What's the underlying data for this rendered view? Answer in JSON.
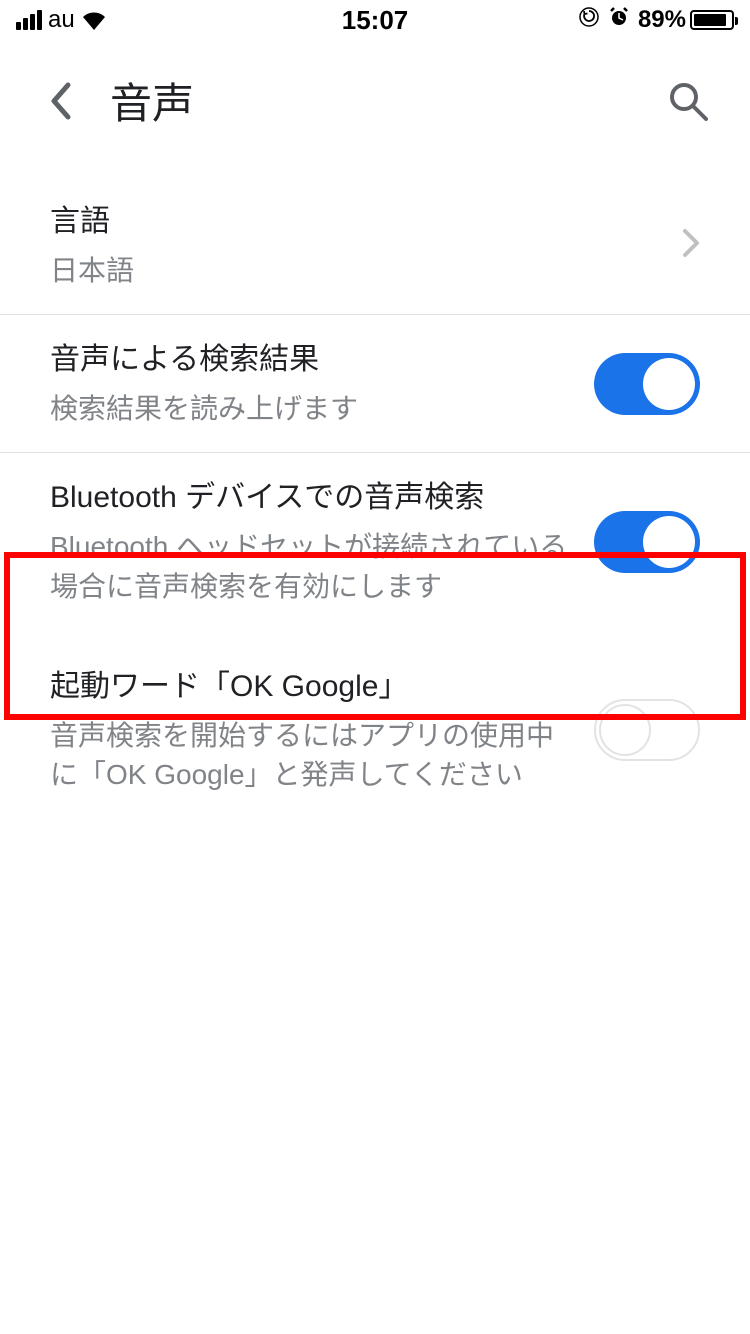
{
  "statusBar": {
    "carrier": "au",
    "time": "15:07",
    "batteryPercent": "89%"
  },
  "header": {
    "title": "音声"
  },
  "settings": {
    "language": {
      "title": "言語",
      "value": "日本語"
    },
    "voiceResults": {
      "title": "音声による検索結果",
      "subtitle": "検索結果を読み上げます",
      "enabled": true
    },
    "bluetooth": {
      "title": "Bluetooth デバイスでの音声検索",
      "subtitle": "Bluetooth ヘッドセットが接続されている場合に音声検索を有効にします",
      "enabled": true
    },
    "okGoogle": {
      "title": "起動ワード「OK Google」",
      "subtitle": "音声検索を開始するにはアプリの使用中に「OK Google」と発声してください",
      "enabled": false
    }
  }
}
